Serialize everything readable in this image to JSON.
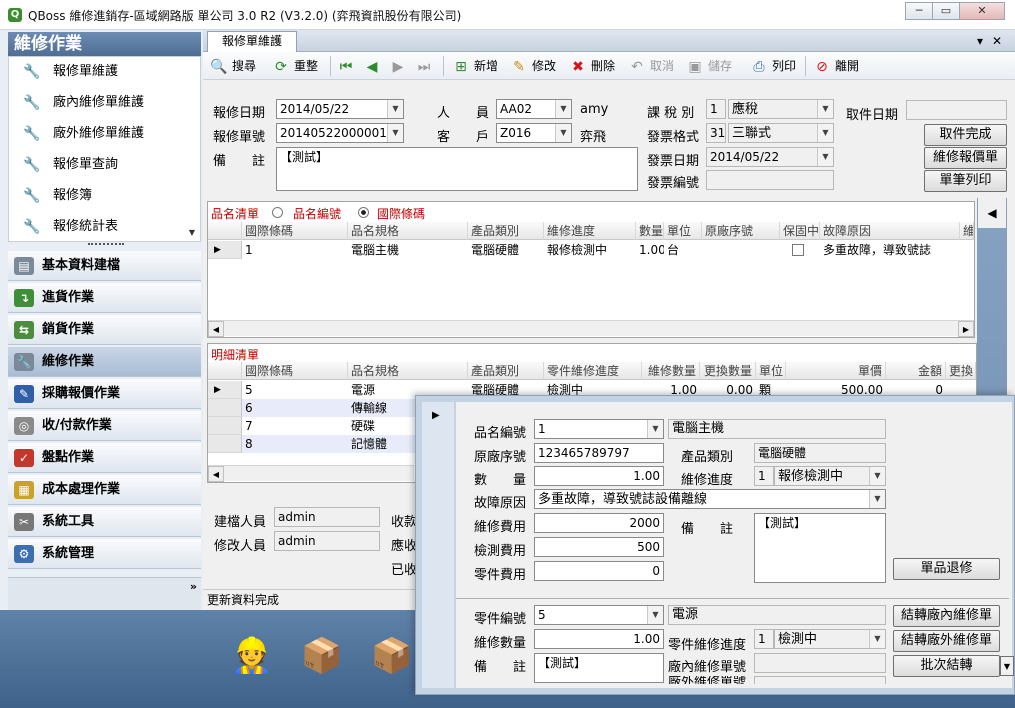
{
  "window": {
    "title": "QBoss 維修進銷存-區域網路版 單公司 3.0 R2 (V3.2.0) (弈飛資訊股份有限公司)",
    "minimize_glyph": "─",
    "restore_glyph": "▭",
    "close_glyph": "✕"
  },
  "sidebar": {
    "header": "維修作業",
    "items": [
      {
        "label": "報修單維護"
      },
      {
        "label": "廠內維修單維護"
      },
      {
        "label": "廠外維修單維護"
      },
      {
        "label": "報修單查詢"
      },
      {
        "label": "報修簿"
      },
      {
        "label": "報修統計表"
      }
    ],
    "categories": [
      {
        "label": "基本資料建檔",
        "icon": "clipboard-icon"
      },
      {
        "label": "進貨作業",
        "icon": "receive-icon"
      },
      {
        "label": "銷貨作業",
        "icon": "sales-icon"
      },
      {
        "label": "維修作業",
        "icon": "wrench-icon"
      },
      {
        "label": "採購報價作業",
        "icon": "purchase-icon"
      },
      {
        "label": "收/付款作業",
        "icon": "coins-icon"
      },
      {
        "label": "盤點作業",
        "icon": "inventory-icon"
      },
      {
        "label": "成本處理作業",
        "icon": "cost-icon"
      },
      {
        "label": "系統工具",
        "icon": "tools-icon"
      },
      {
        "label": "系統管理",
        "icon": "gears-icon"
      }
    ],
    "expand_glyph": "»"
  },
  "tab": {
    "label": "報修單維護",
    "pin_glyph": "▾",
    "close_glyph": "✕"
  },
  "toolbar": {
    "search": "搜尋",
    "reset": "重整",
    "add": "新增",
    "edit": "修改",
    "delete": "刪除",
    "cancel": "取消",
    "save": "儲存",
    "print": "列印",
    "exit": "離開"
  },
  "form": {
    "repair_date_label": "報修日期",
    "repair_date": "2014/05/22",
    "repair_no_label": "報修單號",
    "repair_no": "20140522000001",
    "remark_label": "備　　註",
    "remark": "【測試】",
    "staff_label": "人　　員",
    "staff_code": "AA02",
    "staff_name": "amy",
    "customer_label": "客　　戶",
    "customer_code": "Z016",
    "customer_name": "弈飛",
    "tax_label": "課 稅 別",
    "tax_code": "1",
    "tax_name": "應稅",
    "invoice_format_label": "發票格式",
    "invoice_format_code": "31",
    "invoice_format_name": "三聯式",
    "invoice_date_label": "發票日期",
    "invoice_date": "2014/05/22",
    "invoice_no_label": "發票編號",
    "invoice_no": "",
    "pickup_date_label": "取件日期",
    "pickup_date": "",
    "btn_pickup_done": "取件完成",
    "btn_quote": "維修報價單",
    "btn_print_single": "單筆列印"
  },
  "product_grid": {
    "section": "品名清單",
    "radio1": "品名編號",
    "radio2": "國際條碼",
    "selected_radio": "國際條碼",
    "columns": [
      "國際條碼",
      "品名規格",
      "產品類別",
      "維修進度",
      "數量",
      "單位",
      "原廠序號",
      "保固中",
      "故障原因",
      "維"
    ],
    "rows": [
      {
        "barcode": "1",
        "name": "電腦主機",
        "category": "電腦硬體",
        "progress": "報修檢測中",
        "qty": "1.00",
        "unit": "台",
        "serial": "",
        "warranty": false,
        "fault": "多重故障，導致號誌"
      }
    ]
  },
  "detail_grid": {
    "section": "明細清單",
    "columns": [
      "國際條碼",
      "品名規格",
      "產品類別",
      "零件維修進度",
      "維修數量",
      "更換數量",
      "單位",
      "單價",
      "金額",
      "更換"
    ],
    "rows": [
      {
        "barcode": "5",
        "name": "電源",
        "category": "電腦硬體",
        "progress": "檢測中",
        "repair_qty": "1.00",
        "replace_qty": "0.00",
        "unit": "顆",
        "price": "500.00",
        "amount": "0"
      },
      {
        "barcode": "6",
        "name": "傳輸線",
        "category": "",
        "progress": "",
        "repair_qty": "",
        "replace_qty": "",
        "unit": "",
        "price": "",
        "amount": ""
      },
      {
        "barcode": "7",
        "name": "硬碟",
        "category": "",
        "progress": "",
        "repair_qty": "",
        "replace_qty": "",
        "unit": "",
        "price": "",
        "amount": ""
      },
      {
        "barcode": "8",
        "name": "記憶體",
        "category": "",
        "progress": "",
        "repair_qty": "",
        "replace_qty": "",
        "unit": "",
        "price": "",
        "amount": ""
      }
    ]
  },
  "footer": {
    "creator_label": "建檔人員",
    "creator": "admin",
    "modifier_label": "修改人員",
    "modifier": "admin",
    "receivable_label1": "收款",
    "receivable_label2": "應收",
    "receivable_label3": "已收",
    "status": "更新資料完成"
  },
  "popup": {
    "product_code_label": "品名編號",
    "product_code": "1",
    "product_name": "電腦主機",
    "serial_label": "原廠序號",
    "serial": "123465789797",
    "category_label": "產品類別",
    "category": "電腦硬體",
    "qty_label": "數　　量",
    "qty": "1.00",
    "progress_label": "維修進度",
    "progress_code": "1",
    "progress_name": "報修檢測中",
    "fault_label": "故障原因",
    "fault": "多重故障，導致號誌設備離線",
    "repair_fee_label": "維修費用",
    "repair_fee": "2000",
    "test_fee_label": "檢測費用",
    "test_fee": "500",
    "parts_fee_label": "零件費用",
    "parts_fee": "0",
    "remark_label": "備　　註",
    "remark": "【測試】",
    "btn_return": "單品退修",
    "part_code_label": "零件編號",
    "part_code": "5",
    "part_name": "電源",
    "part_qty_label": "維修數量",
    "part_qty": "1.00",
    "part_progress_label": "零件維修進度",
    "part_progress_code": "1",
    "part_progress_name": "檢測中",
    "part_remark_label": "備　　註",
    "part_remark": "【測試】",
    "inhouse_no_label": "廠內維修單號",
    "inhouse_no": "",
    "outside_no_label": "廠外維修單號",
    "btn_inhouse": "結轉廠內維修單",
    "btn_outside": "結轉廠外維修單",
    "btn_batch": "批次結轉"
  }
}
